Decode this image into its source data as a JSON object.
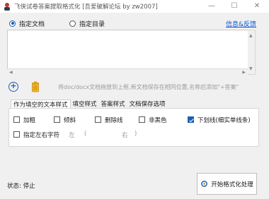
{
  "window": {
    "title": "飞侠试卷答案提取格式化 [吾爱破解论坛 by zw2007]",
    "min_label": "—",
    "max_label": "☐",
    "close_label": "✕"
  },
  "mode": {
    "file_label": "指定文档",
    "dir_label": "指定目录",
    "selected": "file"
  },
  "info_link": "信息&反馈",
  "file_list": [],
  "toolbar": {
    "hint": "将doc/docx文档拖放到上框,新文档保存在相同位置,名称后添加\"+答案\""
  },
  "tabs": [
    {
      "label": "作为填空的文本样式",
      "active": true
    },
    {
      "label": "填空样式",
      "active": false
    },
    {
      "label": "答案样式",
      "active": false
    },
    {
      "label": "文档保存选项",
      "active": false
    }
  ],
  "options": {
    "bold": {
      "label": "加粗",
      "checked": false
    },
    "italic": {
      "label": "倾斜",
      "checked": false
    },
    "strikethrough": {
      "label": "删除线",
      "checked": false
    },
    "non_black": {
      "label": "非黑色",
      "checked": false
    },
    "underline": {
      "label": "下划线(细实单线条)",
      "checked": true
    },
    "wrap_chars": {
      "label": "指定左右字符",
      "checked": false
    },
    "left_label": "左",
    "left_paren": "(",
    "right_label": "右",
    "right_paren": ")"
  },
  "status": "状态: 停止",
  "run_button": "开始格式化处理",
  "colors": {
    "accent": "#1a5fb4",
    "link": "#0b57d0",
    "background": "#f0f0f0"
  },
  "icons": {
    "app": "app-person-icon",
    "add": "add-circle-icon",
    "clear": "trash-can-icon",
    "run": "gear-play-icon"
  }
}
